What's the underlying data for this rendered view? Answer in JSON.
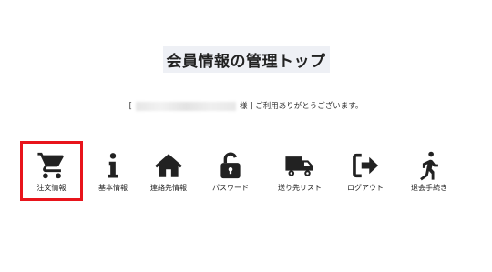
{
  "page": {
    "title": "会員情報の管理トップ",
    "greeting_prefix": "[",
    "greeting_suffix": "様 ] ご利用ありがとうございます。"
  },
  "menu": {
    "items": [
      {
        "label": "注文情報",
        "icon": "cart-icon",
        "selected": true
      },
      {
        "label": "基本情報",
        "icon": "info-icon",
        "selected": false
      },
      {
        "label": "連絡先情報",
        "icon": "home-icon",
        "selected": false
      },
      {
        "label": "パスワード",
        "icon": "unlock-icon",
        "selected": false
      },
      {
        "label": "送り先リスト",
        "icon": "truck-icon",
        "selected": false
      },
      {
        "label": "ログアウト",
        "icon": "logout-icon",
        "selected": false
      },
      {
        "label": "退会手続き",
        "icon": "walking-icon",
        "selected": false
      }
    ]
  },
  "colors": {
    "selected_border": "#e8141b",
    "icon": "#222222"
  }
}
